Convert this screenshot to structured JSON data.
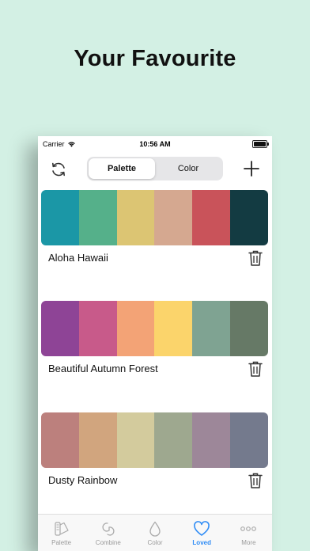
{
  "headline": "Your Favourite",
  "status": {
    "carrier": "Carrier",
    "time": "10:56 AM"
  },
  "segments": [
    {
      "label": "Palette",
      "active": true
    },
    {
      "label": "Color",
      "active": false
    }
  ],
  "palettes": [
    {
      "name": "Aloha Hawaii",
      "colors": [
        "#1b97a6",
        "#55b08a",
        "#dcc573",
        "#d5a890",
        "#c9535a",
        "#133b42"
      ]
    },
    {
      "name": "Beautiful Autumn Forest",
      "colors": [
        "#8e4496",
        "#c85a8a",
        "#f3a376",
        "#fbd46b",
        "#7fa392",
        "#667966"
      ]
    },
    {
      "name": "Dusty Rainbow",
      "colors": [
        "#bc807d",
        "#d1a57e",
        "#d3cb9d",
        "#9ea88f",
        "#9d8799",
        "#747a8d"
      ]
    }
  ],
  "tabs": [
    {
      "label": "Palette",
      "icon": "palette-swatch-icon"
    },
    {
      "label": "Combine",
      "icon": "combine-icon"
    },
    {
      "label": "Color",
      "icon": "droplet-icon"
    },
    {
      "label": "Loved",
      "icon": "heart-icon",
      "active": true
    },
    {
      "label": "More",
      "icon": "more-dots-icon"
    }
  ],
  "accent": "#2f8cf5"
}
